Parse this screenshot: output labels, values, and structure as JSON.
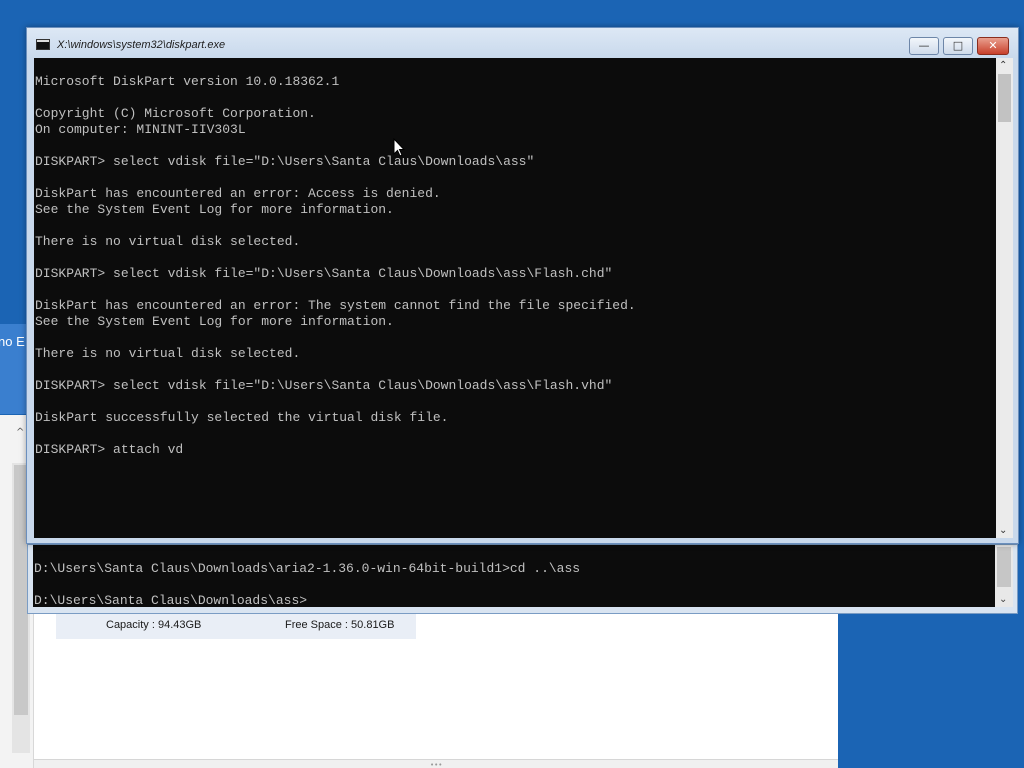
{
  "background_tag": {
    "text": "no E"
  },
  "background_app": {
    "capacity": "Capacity : 94.43GB",
    "free_space": "Free Space : 50.81GB"
  },
  "diskpart_window": {
    "title": "X:\\windows\\system32\\diskpart.exe",
    "buttons": {
      "minimize": "—",
      "maximize": "□",
      "close": "✕"
    },
    "console_lines": [
      "Microsoft DiskPart version 10.0.18362.1",
      "",
      "Copyright (C) Microsoft Corporation.",
      "On computer: MININT-IIV303L",
      "",
      "DISKPART> select vdisk file=\"D:\\Users\\Santa Claus\\Downloads\\ass\"",
      "",
      "DiskPart has encountered an error: Access is denied.",
      "See the System Event Log for more information.",
      "",
      "There is no virtual disk selected.",
      "",
      "DISKPART> select vdisk file=\"D:\\Users\\Santa Claus\\Downloads\\ass\\Flash.chd\"",
      "",
      "DiskPart has encountered an error: The system cannot find the file specified.",
      "See the System Event Log for more information.",
      "",
      "There is no virtual disk selected.",
      "",
      "DISKPART> select vdisk file=\"D:\\Users\\Santa Claus\\Downloads\\ass\\Flash.vhd\"",
      "",
      "DiskPart successfully selected the virtual disk file.",
      "",
      "DISKPART> attach vd"
    ]
  },
  "cmd_window_back": {
    "console_lines": [
      "D:\\Users\\Santa Claus\\Downloads\\aria2-1.36.0-win-64bit-build1>cd ..\\ass",
      "",
      "D:\\Users\\Santa Claus\\Downloads\\ass>"
    ]
  },
  "colors": {
    "desktop": "#1b64b4",
    "console_bg": "#0c0c0c",
    "console_fg": "#c0c0c0",
    "close_button": "#c8402b"
  }
}
